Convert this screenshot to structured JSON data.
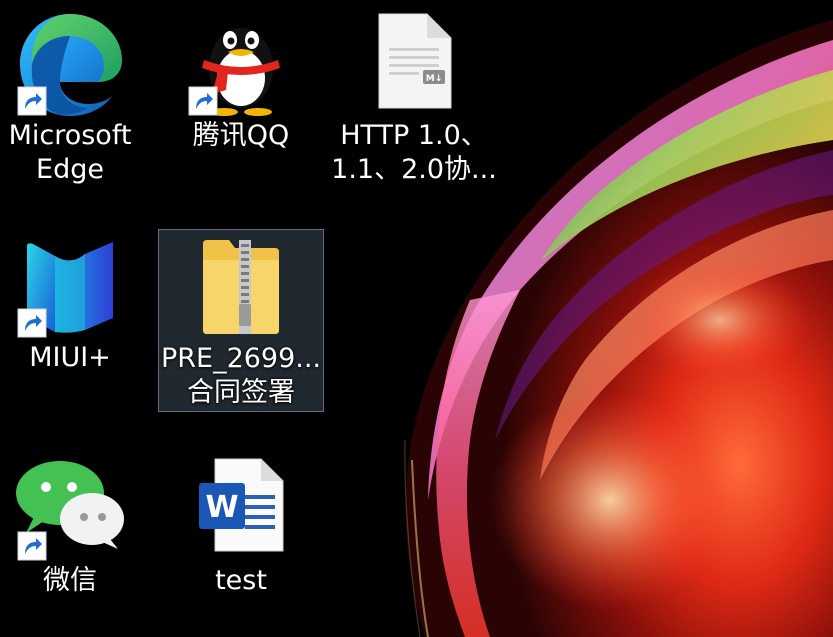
{
  "desktop": {
    "icons": [
      {
        "id": "edge",
        "line1": "Microsoft",
        "line2": "Edge",
        "shortcut": true,
        "icon": "edge-icon"
      },
      {
        "id": "qq",
        "line1": "腾讯QQ",
        "line2": "",
        "shortcut": true,
        "icon": "qq-penguin-icon"
      },
      {
        "id": "markdown",
        "line1": "HTTP 1.0、",
        "line2": "1.1、2.0协...",
        "shortcut": false,
        "icon": "markdown-file-icon"
      },
      {
        "id": "miui",
        "line1": "MIUI+",
        "line2": "",
        "shortcut": true,
        "icon": "miui-plus-icon"
      },
      {
        "id": "zip",
        "line1": "PRE_2699...",
        "line2": "合同签署",
        "shortcut": false,
        "selected": true,
        "icon": "zip-folder-icon"
      },
      {
        "id": "wechat",
        "line1": "微信",
        "line2": "",
        "shortcut": true,
        "icon": "wechat-icon"
      },
      {
        "id": "word",
        "line1": "test",
        "line2": "",
        "shortcut": false,
        "icon": "word-document-icon"
      }
    ]
  },
  "colors": {
    "background": "#000000",
    "selection_fill": "#3a4a56",
    "label_text": "#ffffff"
  }
}
